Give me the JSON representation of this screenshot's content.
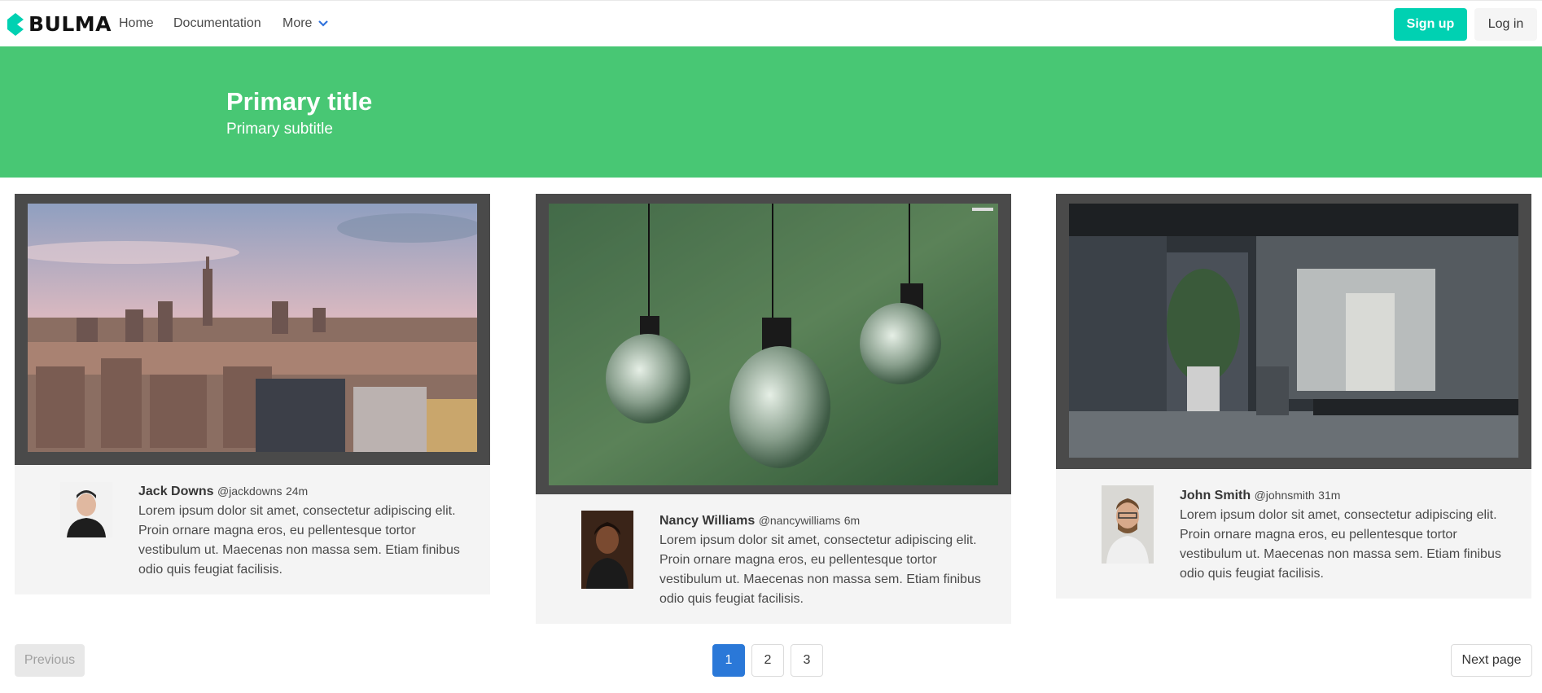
{
  "nav": {
    "brand": "BULMA",
    "links": [
      "Home",
      "Documentation",
      "More"
    ],
    "signup": "Sign up",
    "login": "Log in"
  },
  "hero": {
    "title": "Primary title",
    "subtitle": "Primary subtitle"
  },
  "cards": [
    {
      "name": "Jack Downs",
      "handle": "@jackdowns",
      "time": "24m",
      "text": "Lorem ipsum dolor sit amet, consectetur adipiscing elit. Proin ornare magna eros, eu pellentesque tortor vestibulum ut. Maecenas non massa sem. Etiam finibus odio quis feugiat facilisis."
    },
    {
      "name": "Nancy Williams",
      "handle": "@nancywilliams",
      "time": "6m",
      "text": "Lorem ipsum dolor sit amet, consectetur adipiscing elit. Proin ornare magna eros, eu pellentesque tortor vestibulum ut. Maecenas non massa sem. Etiam finibus odio quis feugiat facilisis."
    },
    {
      "name": "John Smith",
      "handle": "@johnsmith",
      "time": "31m",
      "text": "Lorem ipsum dolor sit amet, consectetur adipiscing elit. Proin ornare magna eros, eu pellentesque tortor vestibulum ut. Maecenas non massa sem. Etiam finibus odio quis feugiat facilisis."
    }
  ],
  "pagination": {
    "previous": "Previous",
    "pages": [
      "1",
      "2",
      "3"
    ],
    "current": "1",
    "next": "Next page"
  },
  "colors": {
    "brand_accent": "#00d1b2",
    "hero_bg": "#48c774",
    "pagination_current": "#2a78d8"
  }
}
